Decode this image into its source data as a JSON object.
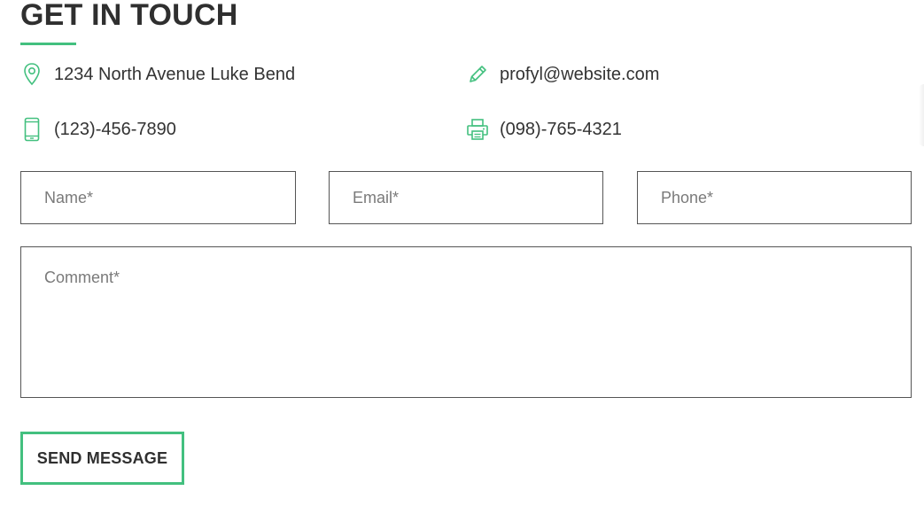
{
  "section": {
    "title": "GET IN TOUCH",
    "accent_color": "#43c07f"
  },
  "contacts": {
    "address": {
      "icon": "map-pin-icon",
      "text": "1234 North Avenue Luke Bend"
    },
    "email": {
      "icon": "pencil-icon",
      "text": "profyl@website.com"
    },
    "phone": {
      "icon": "mobile-phone-icon",
      "text": "(123)-456-7890"
    },
    "fax": {
      "icon": "printer-icon",
      "text": "(098)-765-4321"
    }
  },
  "form": {
    "name_placeholder": "Name*",
    "email_placeholder": "Email*",
    "phone_placeholder": "Phone*",
    "comment_placeholder": "Comment*",
    "submit_label": "SEND MESSAGE"
  }
}
